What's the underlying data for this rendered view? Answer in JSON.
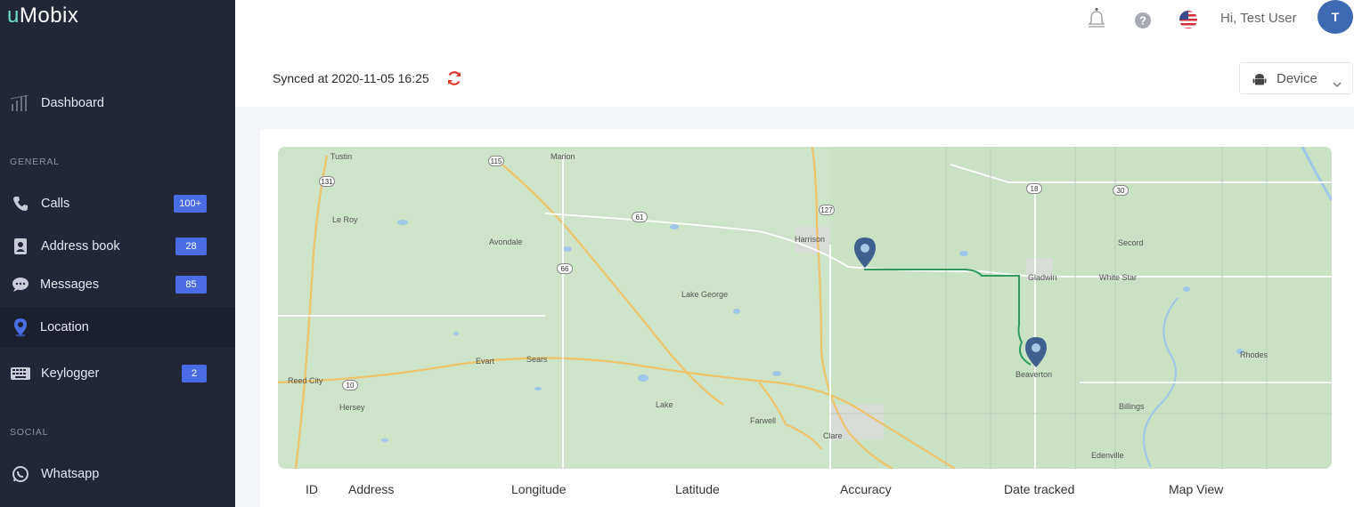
{
  "brand": {
    "prefix": "u",
    "name": "Mobix"
  },
  "sidebar": {
    "dashboard": {
      "label": "Dashboard",
      "icon": "bar-chart-icon"
    },
    "general_label": "GENERAL",
    "items": [
      {
        "label": "Calls",
        "badge": "100+",
        "icon": "phone-icon"
      },
      {
        "label": "Address book",
        "badge": "28",
        "icon": "address-book-icon"
      },
      {
        "label": "Messages",
        "badge": "85",
        "icon": "sms-icon"
      },
      {
        "label": "Location",
        "badge": "",
        "icon": "location-pin-icon",
        "active": true
      },
      {
        "label": "Keylogger",
        "badge": "2",
        "icon": "keyboard-icon"
      }
    ],
    "social_label": "SOCIAL",
    "social_items": [
      {
        "label": "Whatsapp",
        "icon": "whatsapp-icon"
      }
    ]
  },
  "header": {
    "greeting": "Hi, Test User",
    "avatar_initial": "T",
    "icons": [
      "bell-icon",
      "help-icon",
      "us-flag-icon"
    ]
  },
  "sync": {
    "text": "Synced at 2020-11-05 16:25",
    "device_label": "Device"
  },
  "map": {
    "labels": [
      "Tustin",
      "Marion",
      "Le Roy",
      "Avondale",
      "Harrison",
      "Lake George",
      "Gladwin",
      "White Star",
      "Secord",
      "Evart",
      "Sears",
      "Reed City",
      "Hersey",
      "Lake",
      "Farwell",
      "Clare",
      "Beaverton",
      "Rhodes",
      "Billings",
      "Edenville"
    ],
    "road_shields": [
      "131",
      "115",
      "61",
      "127",
      "18",
      "30",
      "66",
      "10"
    ]
  },
  "table": {
    "columns": [
      "ID",
      "Address",
      "Longitude",
      "Latitude",
      "Accuracy",
      "Date tracked",
      "Map View"
    ]
  },
  "colors": {
    "sidebar_bg": "#222738",
    "badge": "#4a6de5",
    "avatar": "#3e6ab3",
    "map_bg": "#cde4c8",
    "route": "#2e9b5a",
    "pin": "#3f5f8f",
    "refresh": "#e0392e"
  }
}
